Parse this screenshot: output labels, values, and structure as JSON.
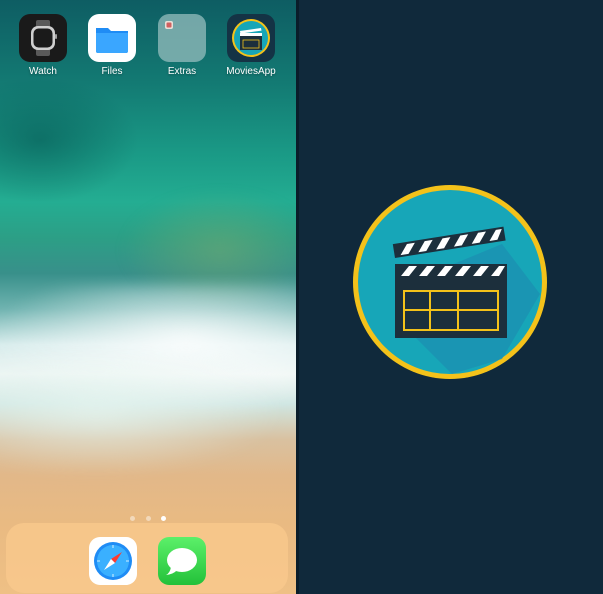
{
  "home_screen": {
    "apps": [
      {
        "label": "Watch",
        "icon": "watch-icon"
      },
      {
        "label": "Files",
        "icon": "folder-icon"
      },
      {
        "label": "Extras",
        "icon": "folder-group-icon"
      },
      {
        "label": "MoviesApp",
        "icon": "clapperboard-icon"
      }
    ],
    "page_indicator": {
      "pages": 3,
      "current": 3
    },
    "dock": [
      {
        "icon": "safari-compass-icon"
      },
      {
        "icon": "messages-bubble-icon"
      }
    ]
  },
  "splash": {
    "logo_icon": "clapperboard-icon",
    "colors": {
      "background": "#10293b",
      "ring": "#f4c21a",
      "circle": "#17a6b8",
      "board": "#1c2f3c",
      "accent": "#f4c21a"
    }
  }
}
